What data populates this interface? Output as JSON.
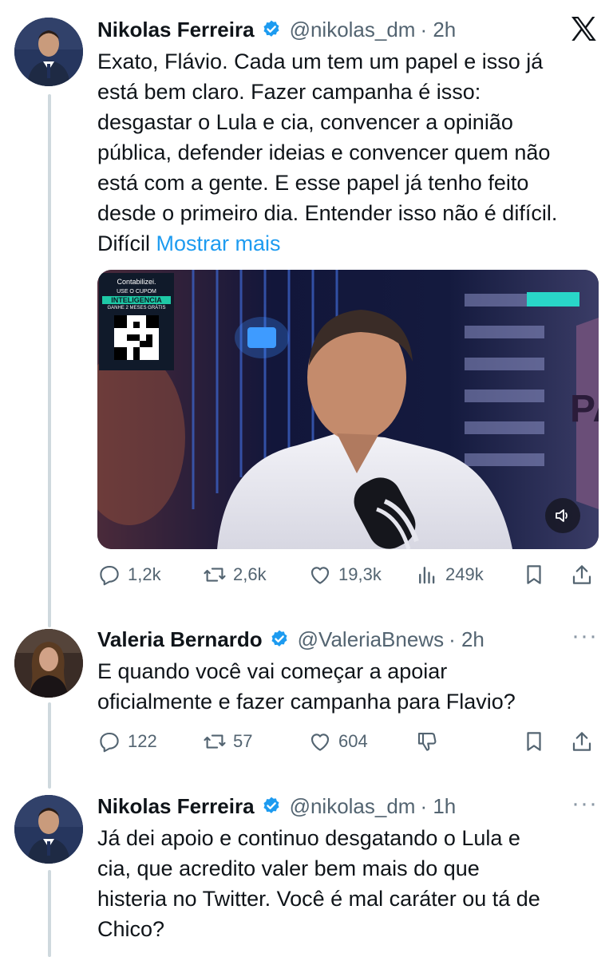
{
  "x_logo": "x-logo",
  "tweets": [
    {
      "name": "Nikolas Ferreira",
      "handle": "@nikolas_dm",
      "time": "· 2h",
      "text": "Exato, Flávio. Cada um tem um papel e isso já\nestá bem claro. Fazer campanha é isso:\ndesgastar o Lula e cia, convencer a opinião\npública, defender ideias e convencer quem não\nestá com a gente. E esse papel já tenho feito\ndesde o primeiro dia. Entender isso não é difícil.\nDifícil ",
      "show_more": "Mostrar mais",
      "media": {
        "overlay_brand": "Contabilizei.",
        "overlay_line1": "USE O CUPOM",
        "overlay_coupon": "INTELIGENCIA",
        "overlay_line2": "GANHE 2 MESES GRÁTIS",
        "sign_text": "PA",
        "sound_icon": "speaker-muted-icon"
      },
      "stats": {
        "replies": "1,2k",
        "reposts": "2,6k",
        "likes": "19,3k",
        "views": "249k"
      }
    },
    {
      "name": "Valeria Bernardo",
      "handle": "@ValeriaBnews",
      "time": "· 2h",
      "text": "E quando você vai começar a apoiar\noficialmente e fazer campanha para Flavio?",
      "stats": {
        "replies": "122",
        "reposts": "57",
        "likes": "604"
      }
    },
    {
      "name": "Nikolas Ferreira",
      "handle": "@nikolas_dm",
      "time": "· 1h",
      "text": "Já dei apoio e continuo desgatando o Lula e\ncia, que acredito valer bem mais do que\nhisteria no Twitter. Você é mal caráter ou tá de\nChico?"
    }
  ],
  "colors": {
    "link": "#1d9bf0",
    "verified": "#1d9bf0",
    "muted": "#536471",
    "thread": "#cfd9de"
  }
}
